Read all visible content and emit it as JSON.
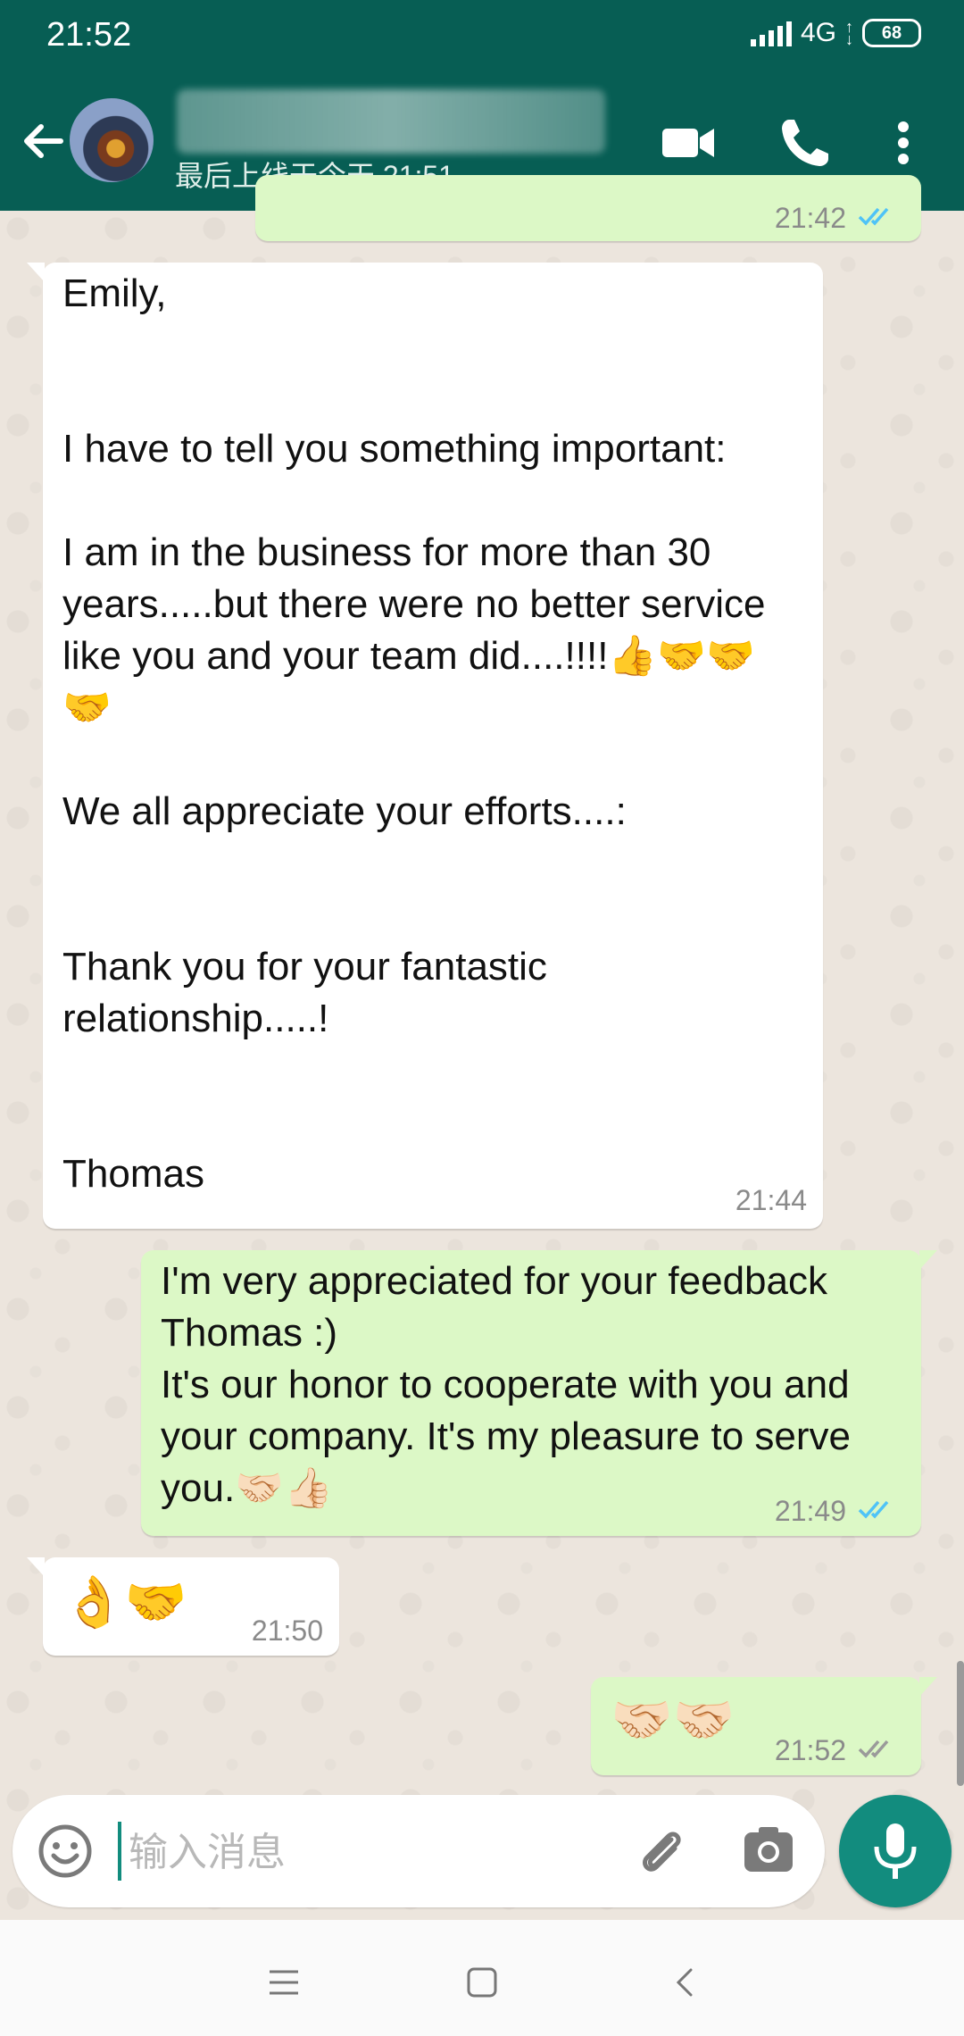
{
  "status_bar": {
    "time": "21:52",
    "network": "4G",
    "battery": "68"
  },
  "header": {
    "last_seen": "最后上线于今天 21:51"
  },
  "messages": [
    {
      "direction": "out",
      "time": "21:42",
      "text": ""
    },
    {
      "direction": "in",
      "time": "21:44",
      "text": "Emily,\n\n\nI have to tell you something important:\n\nI am in the business for more than 30 years.....but there were no better service like you and your team did....!!!!👍🤝🤝\n🤝\n\nWe all appreciate your efforts....:\n\n\nThank you for your fantastic relationship.....!\n\n\nThomas"
    },
    {
      "direction": "out",
      "time": "21:49",
      "text": "I'm very appreciated for your feedback Thomas :)\nIt's our honor to cooperate with you and your company. It's my pleasure to serve you.🤝🏻👍🏻"
    },
    {
      "direction": "in",
      "time": "21:50",
      "text": "👌🤝"
    },
    {
      "direction": "out",
      "time": "21:52",
      "text": "🤝🏻🤝🏻"
    }
  ],
  "composer": {
    "placeholder": "输入消息"
  },
  "icons": {
    "back": "arrow-left-icon",
    "video": "video-camera-icon",
    "call": "phone-icon",
    "menu": "more-vert-icon",
    "emoji": "emoji-icon",
    "attach": "paperclip-icon",
    "camera": "camera-icon",
    "mic": "microphone-icon"
  },
  "colors": {
    "header": "#075e54",
    "outgoing_bubble": "#dcf8c6",
    "incoming_bubble": "#ffffff",
    "accent": "#128c7e",
    "read_ticks": "#4fc3f7"
  }
}
